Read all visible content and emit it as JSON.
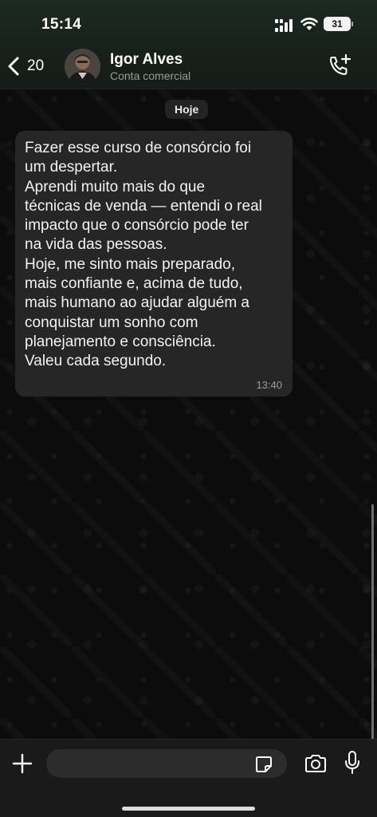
{
  "status_bar": {
    "time": "15:14",
    "battery": "31",
    "icons": [
      "signal-icon",
      "wifi-icon",
      "battery-icon"
    ]
  },
  "header": {
    "back_count": "20",
    "contact_name": "Igor Alves",
    "contact_subtitle": "Conta comercial",
    "icons": [
      "chevron-left-icon",
      "avatar",
      "add-call-icon"
    ]
  },
  "chat": {
    "date_chip": "Hoje",
    "messages": [
      {
        "text": "Fazer esse curso de consórcio foi\num despertar.\nAprendi muito mais do que\ntécnicas de venda — entendi o real\nimpacto que o consórcio pode ter\nna vida das pessoas.\nHoje, me sinto mais preparado,\nmais confiante e, acima de tudo,\nmais humano ao ajudar alguém a\nconquistar um sonho com\nplanejamento e consciência.\nValeu cada segundo.",
        "time": "13:40"
      }
    ]
  },
  "composer": {
    "input_value": "",
    "icons": [
      "plus-icon",
      "sticker-icon",
      "camera-icon",
      "microphone-icon"
    ]
  },
  "colors": {
    "header_bg": "#1c2a22",
    "bubble_bg": "#262626",
    "chat_bg": "#0c0c0c",
    "muted_text": "#9a9a9a"
  }
}
